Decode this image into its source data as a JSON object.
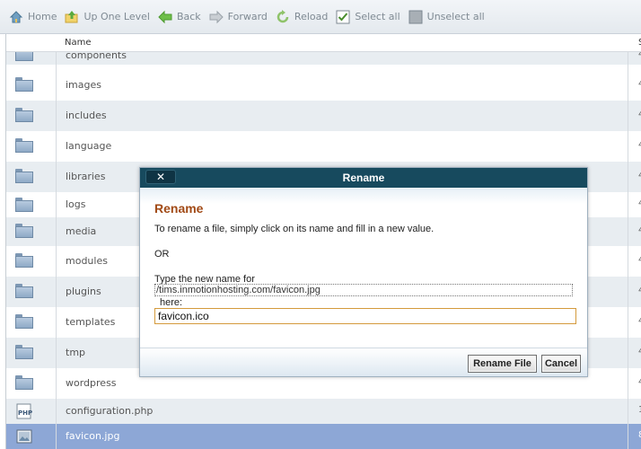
{
  "toolbar": {
    "items": [
      {
        "label": "Home",
        "icon": "home-icon"
      },
      {
        "label": "Up One Level",
        "icon": "up-level-icon"
      },
      {
        "label": "Back",
        "icon": "back-arrow-icon"
      },
      {
        "label": "Forward",
        "icon": "forward-arrow-icon"
      },
      {
        "label": "Reload",
        "icon": "reload-icon"
      },
      {
        "label": "Select all",
        "icon": "select-all-icon"
      },
      {
        "label": "Unselect all",
        "icon": "unselect-all-icon"
      }
    ]
  },
  "table": {
    "header": {
      "name": "Name",
      "size": "S"
    },
    "rows": [
      {
        "name": "components",
        "type": "folder",
        "size": "4"
      },
      {
        "name": "images",
        "type": "folder",
        "size": "4"
      },
      {
        "name": "includes",
        "type": "folder",
        "size": "4"
      },
      {
        "name": "language",
        "type": "folder",
        "size": "4"
      },
      {
        "name": "libraries",
        "type": "folder",
        "size": "4"
      },
      {
        "name": "logs",
        "type": "folder",
        "size": "4"
      },
      {
        "name": "media",
        "type": "folder",
        "size": "4"
      },
      {
        "name": "modules",
        "type": "folder",
        "size": "4"
      },
      {
        "name": "plugins",
        "type": "folder",
        "size": "4"
      },
      {
        "name": "templates",
        "type": "folder",
        "size": "4"
      },
      {
        "name": "tmp",
        "type": "folder",
        "size": "4"
      },
      {
        "name": "wordpress",
        "type": "folder",
        "size": "4"
      },
      {
        "name": "configuration.php",
        "type": "php",
        "size": "1"
      },
      {
        "name": "favicon.jpg",
        "type": "image",
        "size": "8",
        "selected": true
      }
    ]
  },
  "dialog": {
    "title": "Rename",
    "close_label": "✕",
    "heading": "Rename",
    "instruction": "To rename a file, simply click on its name and fill in a new value.",
    "or_label": "OR",
    "type_label": "Type the new name for",
    "path": "/tims.inmotionhosting.com/favicon.jpg",
    "here_label": "here:",
    "input_value": "favicon.ico",
    "rename_button": "Rename File",
    "cancel_button": "Cancel"
  },
  "colors": {
    "dialog_title_bg": "#174a5e",
    "heading": "#a14a16",
    "selected_row": "#8da7d6",
    "input_border": "#d49a3c"
  }
}
